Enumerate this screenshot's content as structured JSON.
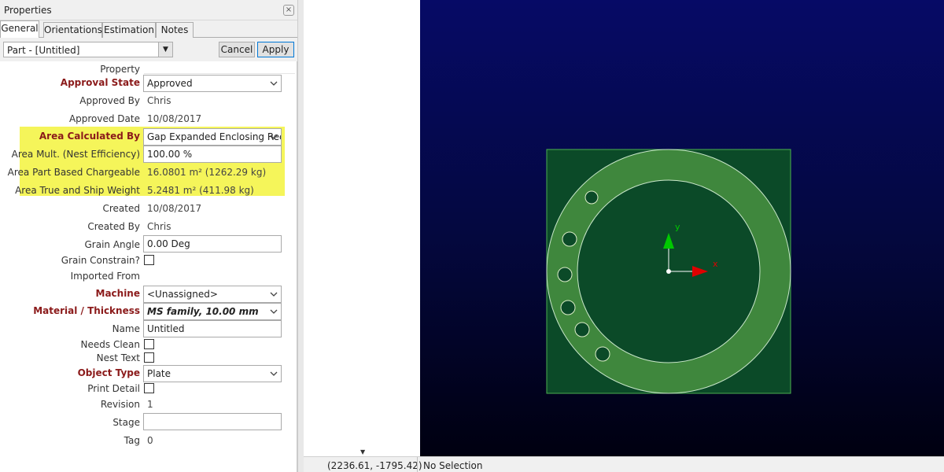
{
  "panel": {
    "title": "Properties",
    "close_icon": "close-icon"
  },
  "tabs": [
    "General",
    "Orientations",
    "Estimation",
    "Notes"
  ],
  "toolbar": {
    "part_value": "Part - [Untitled]",
    "cancel_label": "Cancel",
    "apply_label": "Apply"
  },
  "props": {
    "header": "Property",
    "approval_state": {
      "label": "Approval State",
      "value": "Approved"
    },
    "approved_by": {
      "label": "Approved By",
      "value": "Chris"
    },
    "approved_date": {
      "label": "Approved Date",
      "value": "10/08/2017"
    },
    "area_calculated_by": {
      "label": "Area Calculated By",
      "value": "Gap Expanded Enclosing Rec"
    },
    "area_mult": {
      "label": "Area Mult. (Nest Efficiency)",
      "value": "100.00 %"
    },
    "area_part_based": {
      "label": "Area Part Based Chargeable",
      "value": "16.0801 m² (1262.29 kg)"
    },
    "area_true": {
      "label": "Area True and Ship Weight",
      "value": "5.2481 m² (411.98 kg)"
    },
    "created": {
      "label": "Created",
      "value": "10/08/2017"
    },
    "created_by": {
      "label": "Created By",
      "value": "Chris"
    },
    "grain_angle": {
      "label": "Grain Angle",
      "value": "0.00 Deg"
    },
    "grain_constrain": {
      "label": "Grain Constrain?"
    },
    "imported_from": {
      "label": "Imported From",
      "value": ""
    },
    "machine": {
      "label": "Machine",
      "value": "<Unassigned>"
    },
    "material": {
      "label": "Material / Thickness",
      "value": "MS family, 10.00 mm"
    },
    "name": {
      "label": "Name",
      "value": "Untitled"
    },
    "needs_clean": {
      "label": "Needs Clean"
    },
    "nest_text": {
      "label": "Nest Text"
    },
    "object_type": {
      "label": "Object Type",
      "value": "Plate"
    },
    "print_detail": {
      "label": "Print Detail"
    },
    "revision": {
      "label": "Revision",
      "value": "1"
    },
    "stage": {
      "label": "Stage",
      "value": ""
    },
    "tag": {
      "label": "Tag",
      "value": "0"
    }
  },
  "viewport": {
    "axis_x": "x",
    "axis_y": "y",
    "plate_color": "#0a4a26",
    "ring_color": "#3e8a3c"
  },
  "status": {
    "coords": "(2236.61, -1795.42)",
    "selection": "No Selection"
  }
}
